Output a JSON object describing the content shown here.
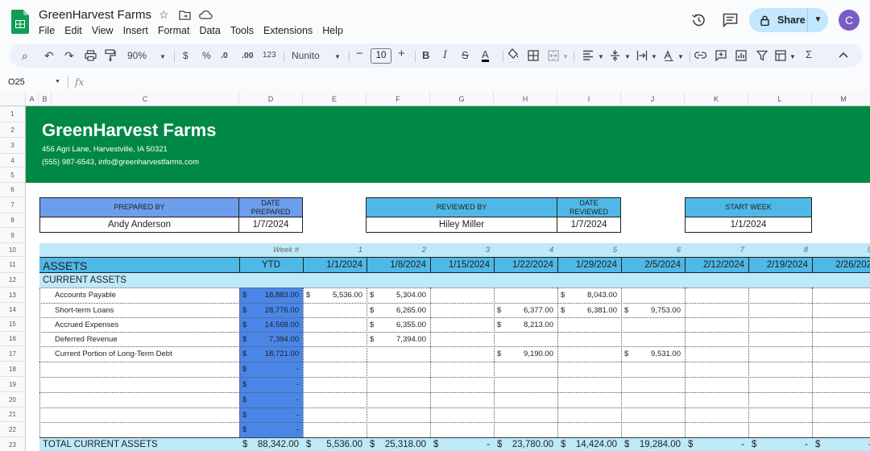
{
  "app": {
    "doc_title": "GreenHarvest Farms",
    "menu": [
      "File",
      "Edit",
      "View",
      "Insert",
      "Format",
      "Data",
      "Tools",
      "Extensions",
      "Help"
    ],
    "share_label": "Share",
    "avatar_letter": "C"
  },
  "toolbar": {
    "zoom": "90%",
    "currency": "$",
    "percent": "%",
    "dec_decrease": ".0",
    "dec_increase": ".00",
    "number_format": "123",
    "font": "Nunito",
    "font_size": "10"
  },
  "formula_bar": {
    "cell_ref": "O25",
    "fx": "fx"
  },
  "columns": [
    "A",
    "B",
    "C",
    "D",
    "E",
    "F",
    "G",
    "H",
    "I",
    "J",
    "K",
    "L",
    "M"
  ],
  "rows": [
    "1",
    "2",
    "3",
    "4",
    "5",
    "6",
    "7",
    "8",
    "9",
    "10",
    "11",
    "12",
    "13",
    "14",
    "15",
    "16",
    "17",
    "18",
    "19",
    "20",
    "21",
    "22",
    "23"
  ],
  "banner": {
    "company": "GreenHarvest Farms",
    "address": "456 Agri Lane, Harvestville, IA 50321",
    "contact": "(555) 987-6543, info@greenharvestfarms.com"
  },
  "prepared": {
    "header": "PREPARED BY",
    "value": "Andy Anderson",
    "date_header": "DATE PREPARED",
    "date": "1/7/2024"
  },
  "reviewed": {
    "header": "REVIEWED BY",
    "value": "Hiley Miller",
    "date_header": "DATE REVIEWED",
    "date": "1/7/2024"
  },
  "start": {
    "header": "START WEEK",
    "value": "1/1/2024"
  },
  "table": {
    "week_label": "Week #",
    "weeks": [
      "1",
      "2",
      "3",
      "4",
      "5",
      "6",
      "7",
      "8",
      "9"
    ],
    "section": "ASSETS",
    "ytd": "YTD",
    "dates": [
      "1/1/2024",
      "1/8/2024",
      "1/15/2024",
      "1/22/2024",
      "1/29/2024",
      "2/5/2024",
      "2/12/2024",
      "2/19/2024",
      "2/26/202"
    ],
    "subsection": "CURRENT ASSETS",
    "items": [
      {
        "label": "Accounts Payable",
        "ytd": "18,883.00",
        "vals": [
          "5,536.00",
          "5,304.00",
          "",
          "",
          "8,043.00",
          "",
          "",
          "",
          ""
        ]
      },
      {
        "label": "Short-term Loans",
        "ytd": "28,776.00",
        "vals": [
          "",
          "6,265.00",
          "",
          "6,377.00",
          "6,381.00",
          "9,753.00",
          "",
          "",
          ""
        ]
      },
      {
        "label": "Accrued Expenses",
        "ytd": "14,568.00",
        "vals": [
          "",
          "6,355.00",
          "",
          "8,213.00",
          "",
          "",
          "",
          "",
          ""
        ]
      },
      {
        "label": "Deferred Revenue",
        "ytd": "7,394.00",
        "vals": [
          "",
          "7,394.00",
          "",
          "",
          "",
          "",
          "",
          "",
          ""
        ]
      },
      {
        "label": "Current Portion of Long-Term Debt",
        "ytd": "18,721.00",
        "vals": [
          "",
          "",
          "",
          "9,190.00",
          "",
          "9,531.00",
          "",
          "",
          ""
        ]
      },
      {
        "label": "",
        "ytd": "-",
        "vals": [
          "",
          "",
          "",
          "",
          "",
          "",
          "",
          "",
          ""
        ]
      },
      {
        "label": "",
        "ytd": "-",
        "vals": [
          "",
          "",
          "",
          "",
          "",
          "",
          "",
          "",
          ""
        ]
      },
      {
        "label": "",
        "ytd": "-",
        "vals": [
          "",
          "",
          "",
          "",
          "",
          "",
          "",
          "",
          ""
        ]
      },
      {
        "label": "",
        "ytd": "-",
        "vals": [
          "",
          "",
          "",
          "",
          "",
          "",
          "",
          "",
          ""
        ]
      },
      {
        "label": "",
        "ytd": "-",
        "vals": [
          "",
          "",
          "",
          "",
          "",
          "",
          "",
          "",
          ""
        ]
      }
    ],
    "total_label": "TOTAL CURRENT ASSETS",
    "total_ytd": "88,342.00",
    "totals": [
      "5,536.00",
      "25,318.00",
      "-",
      "23,780.00",
      "14,424.00",
      "19,284.00",
      "-",
      "-",
      "-"
    ],
    "currency": "$"
  },
  "colors": {
    "banner": "#008946",
    "header_blue": "#4fb8e6",
    "light_blue": "#bde9f8",
    "ytd_blue": "#4a86e8",
    "prepared_blue": "#6d9eeb"
  }
}
